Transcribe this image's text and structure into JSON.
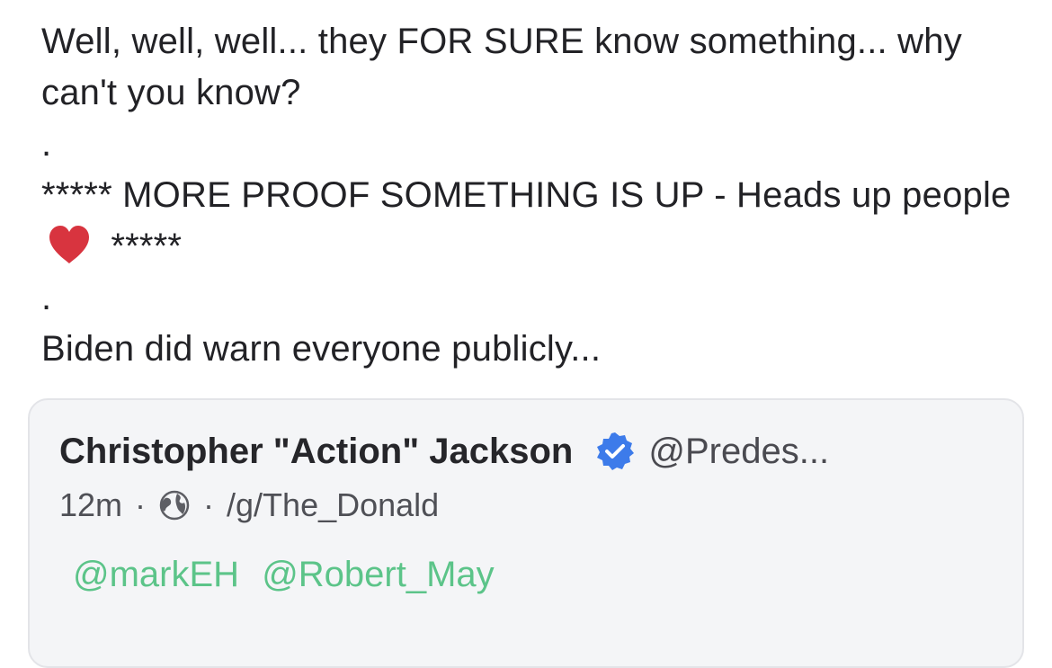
{
  "post": {
    "line1": "Well, well, well... they FOR SURE know something... why can't you know?",
    "dot1": ".",
    "line2_start": "***** MORE PROOF SOMETHING IS UP - Heads up people",
    "line2_end": "*****",
    "dot2": ".",
    "line3": "Biden did warn everyone publicly..."
  },
  "quote": {
    "author_name": "Christopher \"Action\" Jackson",
    "handle": "@Predes...",
    "time": "12m",
    "separator": "·",
    "group": "/g/The_Donald",
    "mentions": [
      "@markEH",
      "@Robert_May"
    ]
  },
  "colors": {
    "mention": "#5cc489",
    "verified": "#3d7bea",
    "heart": "#d8343f"
  },
  "icons": {
    "heart": "heart-icon",
    "verified": "verified-badge-icon",
    "globe": "globe-icon"
  }
}
